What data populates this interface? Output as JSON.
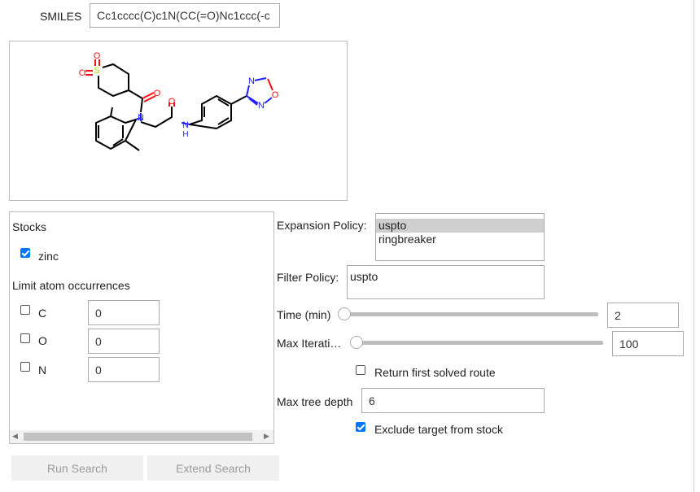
{
  "smiles": {
    "label": "SMILES",
    "value": "Cc1cccc(C)c1N(CC(=O)Nc1ccc(-c"
  },
  "molecule": {
    "atom_labels": {
      "S": "S",
      "O": "O",
      "N": "N",
      "NH": "H"
    }
  },
  "stocks": {
    "title": "Stocks",
    "items": [
      {
        "label": "zinc",
        "checked": true
      }
    ],
    "limit_title": "Limit atom occurrences",
    "atoms": [
      {
        "label": "C",
        "checked": false,
        "value": "0"
      },
      {
        "label": "O",
        "checked": false,
        "value": "0"
      },
      {
        "label": "N",
        "checked": false,
        "value": "0"
      }
    ]
  },
  "settings": {
    "expansion_label": "Expansion Policy:",
    "expansion_options": [
      "uspto",
      "ringbreaker"
    ],
    "expansion_selected": "uspto",
    "filter_label": "Filter Policy:",
    "filter_options": [
      "uspto"
    ],
    "time_label": "Time (min)",
    "time_value": "2",
    "iter_label": "Max Iterati…",
    "iter_value": "100",
    "return_first_label": "Return first solved route",
    "return_first_checked": false,
    "depth_label": "Max tree depth",
    "depth_value": "6",
    "exclude_label": "Exclude target from stock",
    "exclude_checked": true
  },
  "buttons": {
    "run": "Run Search",
    "extend": "Extend Search"
  },
  "colors": {
    "accent": "#0075ff",
    "oxygen": "#ff0d0d",
    "nitrogen": "#2020ff",
    "sulfur": "#c8c800"
  }
}
